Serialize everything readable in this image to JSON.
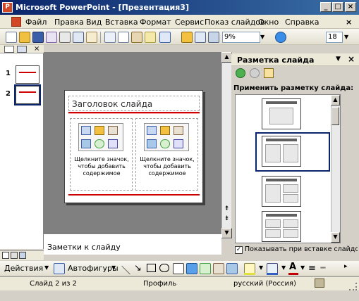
{
  "window": {
    "title": "Microsoft PowerPoint - [Презентация3]",
    "minimize": "_",
    "maximize": "□",
    "close": "×"
  },
  "menu": {
    "items": [
      "Файл",
      "Правка",
      "Вид",
      "Вставка",
      "Формат",
      "Сервис",
      "Показ слайдов",
      "Окно",
      "Справка"
    ],
    "close": "×"
  },
  "toolbar": {
    "zoom": "9%",
    "font_size": "18"
  },
  "thumbnails": {
    "slides": [
      "1",
      "2"
    ]
  },
  "slide": {
    "title_placeholder": "Заголовок слайда",
    "content_left": "Щелкните значок, чтобы добавить содержимое",
    "content_right": "Щелкните значок, чтобы добавить содержимое"
  },
  "notes": {
    "placeholder": "Заметки к слайду"
  },
  "taskpane": {
    "title": "Разметка слайда",
    "section_label": "Применить разметку слайда:",
    "checkbox_label": "Показывать при вставке слайдов",
    "checkbox_checked": true
  },
  "drawbar": {
    "actions_label": "Действия",
    "autoshapes_label": "Автофигуры"
  },
  "status": {
    "slide_info": "Слайд 2 из 2",
    "design": "Профиль",
    "language": "русский (Россия)"
  }
}
